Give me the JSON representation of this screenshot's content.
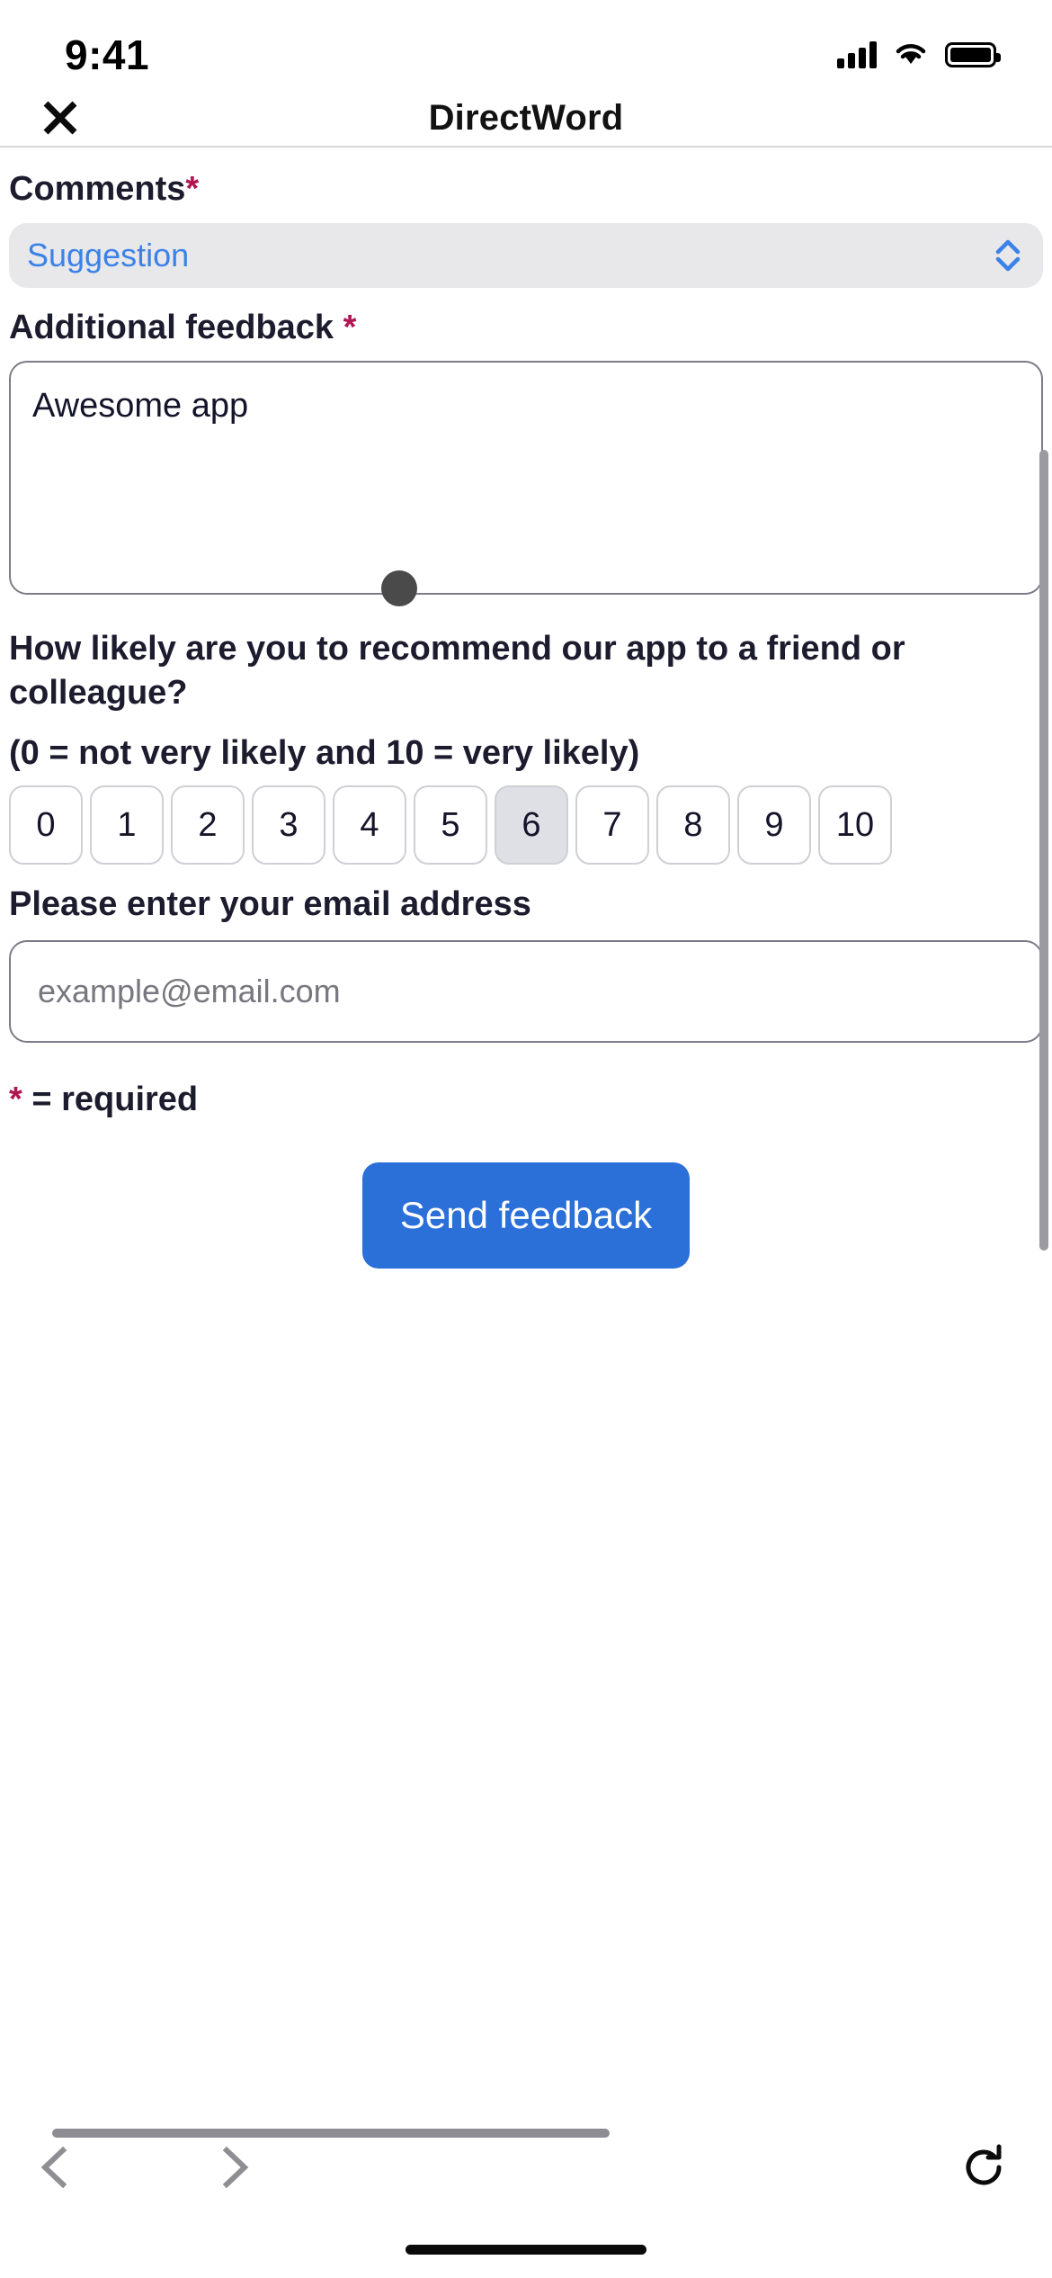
{
  "status_bar": {
    "time": "9:41",
    "cellular_icon": "signal-bars-icon",
    "wifi_icon": "wifi-icon",
    "battery_icon": "battery-full-icon"
  },
  "header": {
    "title": "DirectWord",
    "close_label": "close-icon"
  },
  "form": {
    "comments": {
      "label": "Comments",
      "required_marker": "*",
      "selected_value": "Suggestion",
      "stepper_icon": "chevron-up-down-icon"
    },
    "additional_feedback": {
      "label": "Additional feedback",
      "required_marker": "*",
      "value": "Awesome app"
    },
    "nps": {
      "question": "How likely are you to recommend our app to a friend or colleague?",
      "scale_hint": "(0 = not very likely and 10 = very likely)",
      "options": [
        "0",
        "1",
        "2",
        "3",
        "4",
        "5",
        "6",
        "7",
        "8",
        "9",
        "10"
      ],
      "selected": "6"
    },
    "email": {
      "label": "Please enter your email address",
      "placeholder": "example@email.com",
      "value": ""
    },
    "required_note": "* = required",
    "required_note_marker": "*",
    "required_note_text": " = required",
    "submit_label": "Send feedback"
  },
  "toolbar": {
    "back_icon": "chevron-left-icon",
    "forward_icon": "chevron-right-icon",
    "reload_icon": "reload-icon"
  },
  "colors": {
    "accent_blue": "#2b6fd8",
    "select_text_blue": "#3b82e8",
    "required_crimson": "#b01552",
    "selected_chip": "#dfdfe6",
    "field_border": "#7c7c88"
  }
}
